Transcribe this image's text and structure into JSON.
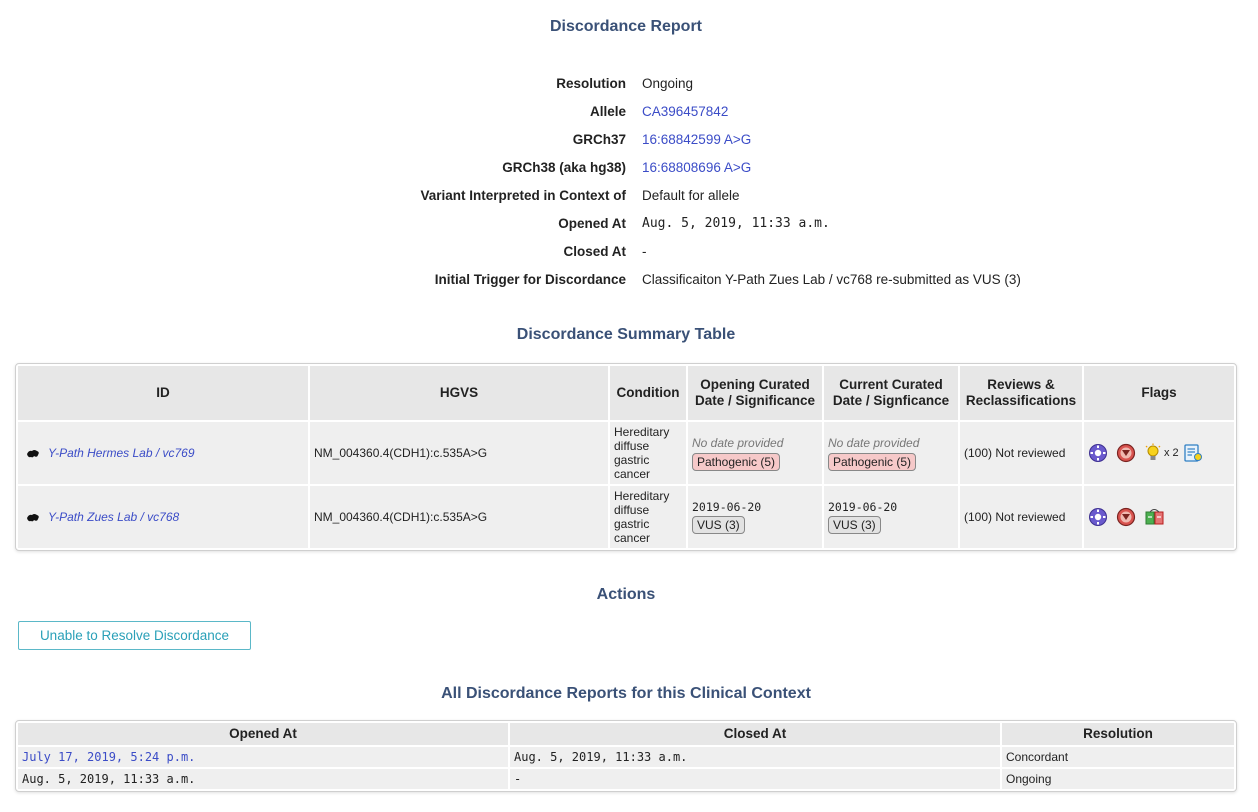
{
  "page_title": "Discordance Report",
  "details": [
    {
      "key": "Resolution",
      "value": "Ongoing",
      "style": "text"
    },
    {
      "key": "Allele",
      "value": "CA396457842",
      "style": "link"
    },
    {
      "key": "GRCh37",
      "value": "16:68842599 A>G",
      "style": "link"
    },
    {
      "key": "GRCh38 (aka hg38)",
      "value": "16:68808696 A>G",
      "style": "link"
    },
    {
      "key": "Variant Interpreted in Context of",
      "value": "Default for allele",
      "style": "text"
    },
    {
      "key": "Opened At",
      "value": "Aug. 5, 2019, 11:33 a.m.",
      "style": "mono"
    },
    {
      "key": "Closed At",
      "value": "-",
      "style": "text"
    },
    {
      "key": "Initial Trigger for Discordance",
      "value": "Classificaiton Y-Path Zues Lab / vc768 re-submitted as VUS (3)",
      "style": "text"
    }
  ],
  "summary": {
    "title": "Discordance Summary Table",
    "headers": {
      "id": "ID",
      "hgvs": "HGVS",
      "condition": "Condition",
      "opening": "Opening Curated Date / Significance",
      "current": "Current Curated Date / Signficance",
      "reviews": "Reviews & Reclassifications",
      "flags": "Flags"
    },
    "rows": [
      {
        "id": "Y-Path Hermes Lab / vc769",
        "hgvs": "NM_004360.4(CDH1):c.535A>G",
        "condition": "Hereditary diffuse gastric cancer",
        "opening_date": "No date provided",
        "opening_sig": "Pathogenic (5)",
        "current_date": "No date provided",
        "current_sig": "Pathogenic (5)",
        "reviews": "(100) Not reviewed",
        "flag_count": "x 2"
      },
      {
        "id": "Y-Path Zues Lab / vc768",
        "hgvs": "NM_004360.4(CDH1):c.535A>G",
        "condition": "Hereditary diffuse gastric cancer",
        "opening_date": "2019-06-20",
        "opening_sig": "VUS (3)",
        "current_date": "2019-06-20",
        "current_sig": "VUS (3)",
        "reviews": "(100) Not reviewed"
      }
    ]
  },
  "actions": {
    "title": "Actions",
    "button": "Unable to Resolve Discordance"
  },
  "history": {
    "title": "All Discordance Reports for this Clinical Context",
    "headers": {
      "opened": "Opened At",
      "closed": "Closed At",
      "resolution": "Resolution"
    },
    "rows": [
      {
        "opened": "July 17, 2019, 5:24 p.m.",
        "closed": "Aug. 5, 2019, 11:33 a.m.",
        "resolution": "Concordant"
      },
      {
        "opened": "Aug. 5, 2019, 11:33 a.m.",
        "closed": "-",
        "resolution": "Ongoing"
      }
    ]
  },
  "colors": {
    "heading": "#3a5177",
    "link": "#3b4cc7",
    "pathogenic_badge": "#f6c9c9",
    "button_border": "#5bb8c8"
  },
  "icons": [
    "globe-icon",
    "gear-icon",
    "no-entry-icon",
    "lightbulb-icon",
    "note-icon",
    "tags-icon"
  ]
}
